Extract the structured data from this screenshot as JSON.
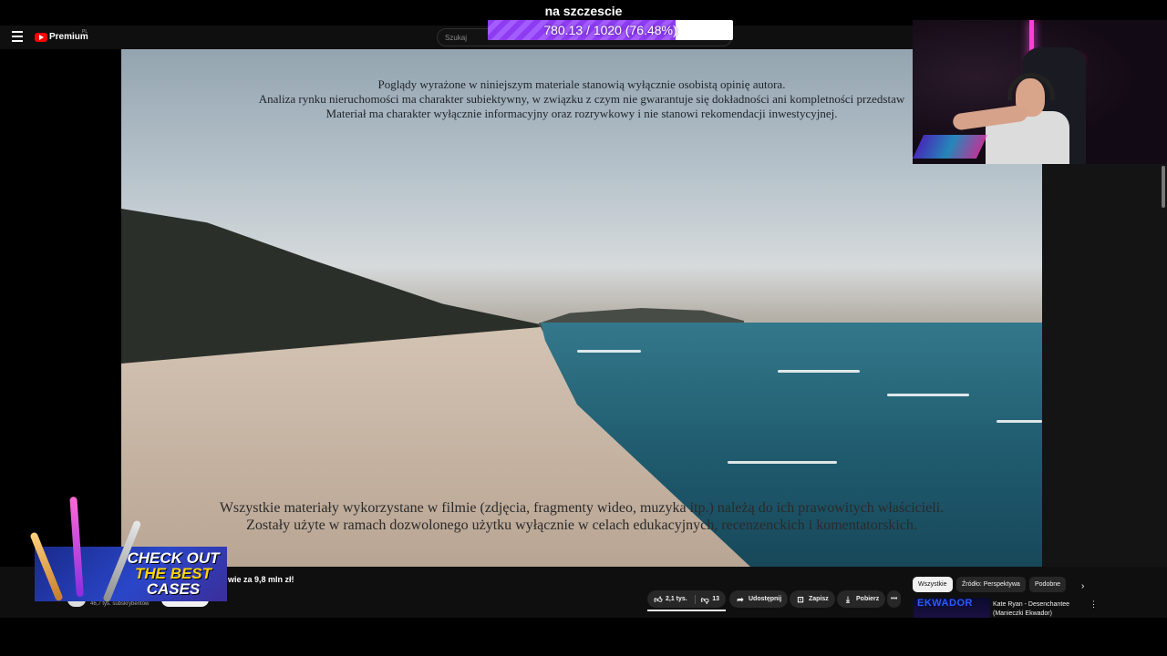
{
  "overlay": {
    "title": "na szczescie",
    "progress": {
      "current": 780.13,
      "goal": 1020,
      "percent": 76.48,
      "text": "780.13 / 1020 (76.48%)",
      "color": "#8e3cf2"
    }
  },
  "header": {
    "logo": "Premium",
    "logo_region": "PL",
    "search_placeholder": "Szukaj"
  },
  "video": {
    "disclaimer_top": [
      "Poglądy wyrażone w niniejszym materiale stanowią wyłącznie osobistą opinię autora.",
      "Analiza rynku nieruchomości ma charakter subiektywny, w związku z czym nie gwarantuje się dokładności ani kompletności przedstaw",
      "Materiał ma charakter wyłącznie informacyjny oraz rozrywkowy i nie stanowi rekomendacji inwestycyjnej."
    ],
    "disclaimer_bottom": [
      "Wszystkie materiały wykorzystane w filmie (zdjęcia, fragmenty wideo, muzyka itp.) należą do ich prawowitych właścicieli.",
      "Zostały użyte w ramach dozwolonego użytku wyłącznie w celach edukacyjnych, recenzenckich i komentatorskich."
    ]
  },
  "info": {
    "title": "wie za 9,8 mln zł!",
    "subscribers": "46,7 tys. subskrybentów",
    "likes": "2,1 tys.",
    "dislikes": "13",
    "share": "Udostępnij",
    "save": "Zapisz",
    "download": "Pobierz",
    "more": "•••"
  },
  "sidebar": {
    "chips": [
      "Wszystkie",
      "Źródło: Perspektywa",
      "Podobne"
    ],
    "active_chip": 0,
    "recommendation": {
      "thumb_text": "EKWADOR",
      "title": "Kate Ryan - Desenchantee (Manieczki Ekwador)"
    }
  },
  "promo": {
    "lines": [
      "CHECK OUT",
      "THE BEST",
      "CASES"
    ]
  },
  "icons": [
    "menu-icon",
    "youtube-logo-icon",
    "like-icon",
    "dislike-icon",
    "share-icon",
    "save-icon",
    "download-icon",
    "chevron-right-icon",
    "more-vert-icon"
  ]
}
